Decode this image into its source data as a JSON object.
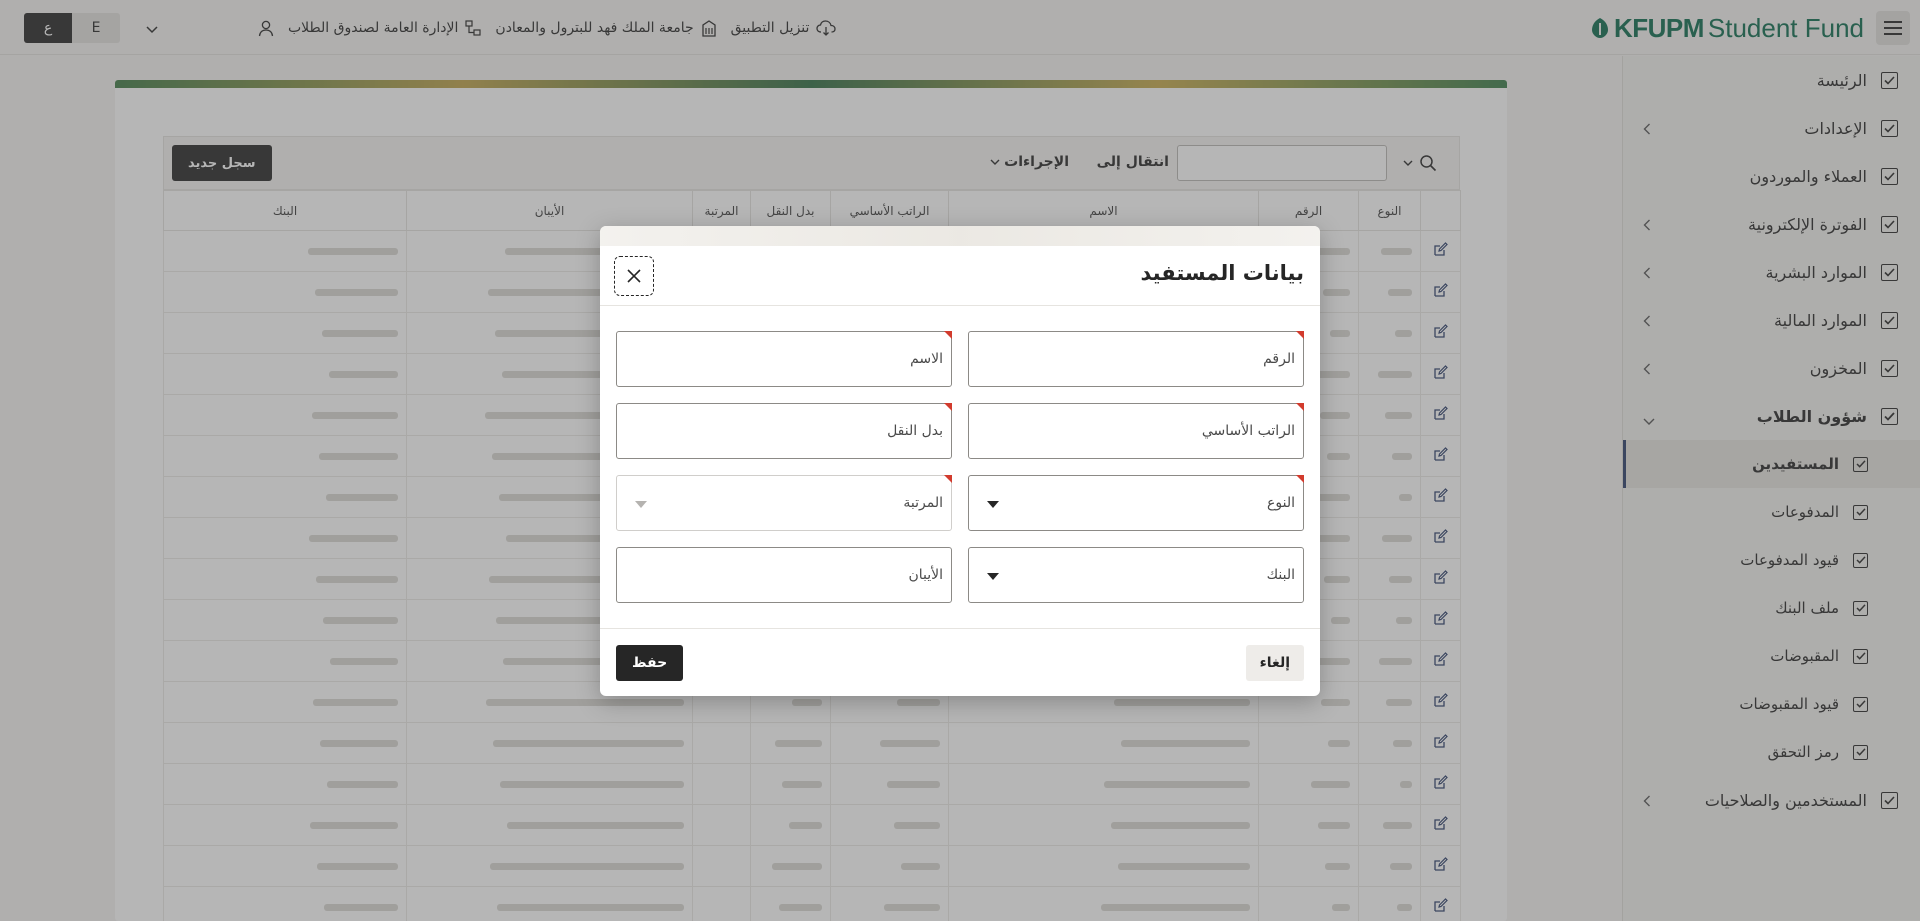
{
  "header": {
    "brand_primary": "KFUPM",
    "brand_secondary": "Student Fund",
    "download_app": "تنزيل التطبيق",
    "university": "جامعة الملك فهد للبترول والمعادن",
    "department": "الإدارة العامة لصندوق الطلاب",
    "lang_ar": "ع",
    "lang_en": "E"
  },
  "sidebar": {
    "items": [
      {
        "label": "الرئيسة"
      },
      {
        "label": "الإعدادات"
      },
      {
        "label": "العملاء والموردون"
      },
      {
        "label": "الفوترة الإلكترونية"
      },
      {
        "label": "الموارد البشرية"
      },
      {
        "label": "الموارد المالية"
      },
      {
        "label": "المخزون"
      },
      {
        "label": "شؤون الطلاب"
      },
      {
        "label": "المستفيدين"
      },
      {
        "label": "المدفوعات"
      },
      {
        "label": "قيود المدفوعات"
      },
      {
        "label": "ملف البنك"
      },
      {
        "label": "المقبوضات"
      },
      {
        "label": "قيود المقبوضات"
      },
      {
        "label": "رمز التحقق"
      },
      {
        "label": "المستخدمين والصلاحيات"
      }
    ]
  },
  "toolbar": {
    "goto_label": "انتقال إلى",
    "actions_label": "الإجراءات",
    "new_record_label": "سجل جديد"
  },
  "table": {
    "columns": [
      "النوع",
      "الرقم",
      "الاسم",
      "الراتب الأساسي",
      "بدل النقل",
      "المرتبة",
      "الأيبان",
      "البنك"
    ]
  },
  "dialog": {
    "title": "بيانات المستفيد",
    "fields": {
      "number": "الرقم",
      "name": "الاسم",
      "basic_salary": "الراتب الأساسي",
      "transport": "بدل النقل",
      "type": "النوع",
      "rank": "المرتبة",
      "bank": "البنك",
      "iban": "الأيبان"
    },
    "cancel_label": "إلغاء",
    "save_label": "حفظ"
  },
  "colors": {
    "brand": "#0d6b4e",
    "accent_dark": "#262626",
    "required_marker": "#d23b2d",
    "active_indicator": "#2c3e6b"
  }
}
